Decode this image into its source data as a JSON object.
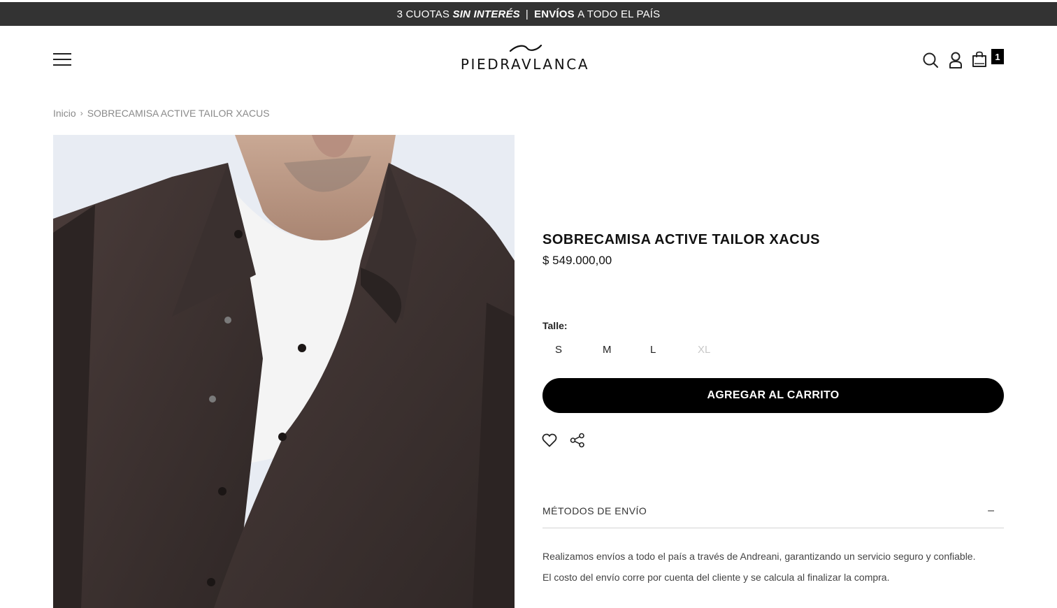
{
  "promo": {
    "part1": "3 CUOTAS",
    "part2": "SIN INTERÉS",
    "separator": "|",
    "part3": "ENVÍOS",
    "part4": "A TODO EL PAÍS"
  },
  "header": {
    "logo_text": "PIEDRAVLANCA",
    "cart_count": "1"
  },
  "breadcrumb": {
    "home": "Inicio",
    "separator": "›",
    "current": "SOBRECAMISA ACTIVE TAILOR XACUS"
  },
  "product": {
    "title": "SOBRECAMISA ACTIVE TAILOR XACUS",
    "price": "$ 549.000,00",
    "size_label": "Talle:",
    "sizes": [
      {
        "label": "S",
        "available": true
      },
      {
        "label": "M",
        "available": true
      },
      {
        "label": "L",
        "available": true
      },
      {
        "label": "XL",
        "available": false
      }
    ],
    "add_to_cart_label": "AGREGAR AL CARRITO"
  },
  "shipping": {
    "title": "MÉTODOS DE ENVÍO",
    "toggle": "–",
    "paragraphs": [
      "Realizamos envíos a todo el país a través de Andreani, garantizando un servicio seguro y confiable.",
      "El costo del envío corre por cuenta del cliente y se calcula al finalizar la compra."
    ]
  },
  "icons": {
    "menu": "hamburger-menu-icon",
    "search": "search-icon",
    "account": "user-icon",
    "cart": "shopping-bag-icon",
    "wishlist": "heart-icon",
    "share": "share-icon"
  },
  "colors": {
    "promo_bg": "#333333",
    "button_bg": "#000000",
    "breadcrumb_text": "#8a8a8a",
    "disabled_size": "#c8c8c8"
  }
}
